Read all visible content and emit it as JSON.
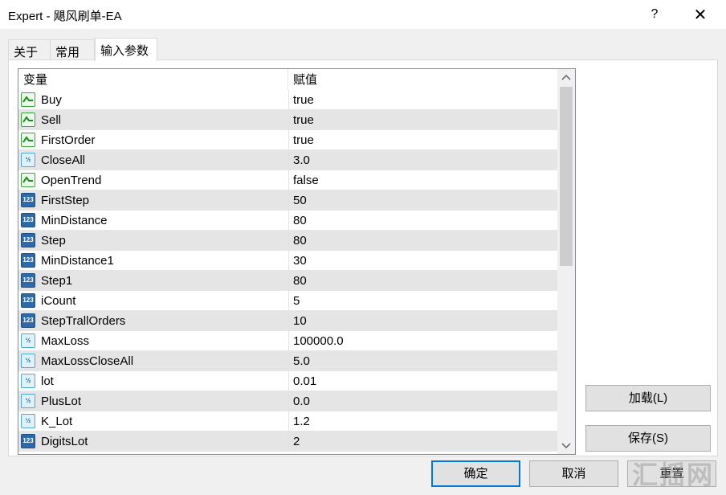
{
  "window": {
    "title": "Expert - 飓风刷单-EA",
    "help_label": "?",
    "close_label": "✕"
  },
  "tabs": [
    {
      "label": "关于"
    },
    {
      "label": "常用"
    },
    {
      "label": "输入参数",
      "active": true
    }
  ],
  "grid": {
    "header_variable": "变量",
    "header_value": "赋值",
    "rows": [
      {
        "type": "bool",
        "name": "Buy",
        "value": "true"
      },
      {
        "type": "bool",
        "name": "Sell",
        "value": "true"
      },
      {
        "type": "bool",
        "name": "FirstOrder",
        "value": "true"
      },
      {
        "type": "double",
        "name": "CloseAll",
        "value": "3.0"
      },
      {
        "type": "bool",
        "name": "OpenTrend",
        "value": "false"
      },
      {
        "type": "int",
        "name": "FirstStep",
        "value": "50"
      },
      {
        "type": "int",
        "name": "MinDistance",
        "value": "80"
      },
      {
        "type": "int",
        "name": "Step",
        "value": "80"
      },
      {
        "type": "int",
        "name": "MinDistance1",
        "value": "30"
      },
      {
        "type": "int",
        "name": "Step1",
        "value": "80"
      },
      {
        "type": "int",
        "name": "iCount",
        "value": "5"
      },
      {
        "type": "int",
        "name": "StepTrallOrders",
        "value": "10"
      },
      {
        "type": "double",
        "name": "MaxLoss",
        "value": "100000.0"
      },
      {
        "type": "double",
        "name": "MaxLossCloseAll",
        "value": "5.0"
      },
      {
        "type": "double",
        "name": "lot",
        "value": "0.01"
      },
      {
        "type": "double",
        "name": "PlusLot",
        "value": "0.0"
      },
      {
        "type": "double",
        "name": "K_Lot",
        "value": "1.2"
      },
      {
        "type": "int",
        "name": "DigitsLot",
        "value": "2"
      }
    ],
    "icon_text": {
      "double": "½",
      "int": "123"
    }
  },
  "buttons": {
    "load": "加载(L)",
    "save": "保存(S)",
    "ok": "确定",
    "cancel": "取消",
    "reset": "重置"
  },
  "watermark": "汇摇网",
  "colors": {
    "focus_border": "#0078d7",
    "alt_row": "#e5e5e5",
    "bool_icon": "#36a736",
    "double_icon": "#4aa7d6",
    "int_icon": "#2f6aa8"
  }
}
